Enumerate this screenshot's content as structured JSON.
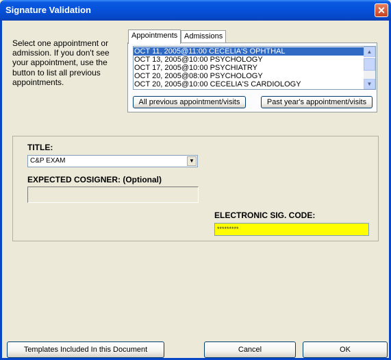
{
  "window": {
    "title": "Signature Validation",
    "close_glyph": "✕"
  },
  "instruction": "Select one appointment or admission.  If you don't see your appointment, use the button to list all previous appointments.",
  "tabs": [
    {
      "label": "Appointments",
      "active": true
    },
    {
      "label": "Admissions",
      "active": false
    }
  ],
  "appointments": [
    "OCT 11, 2005@11:00  CECELIA'S OPHTHAL",
    "OCT 13, 2005@10:00  PSYCHOLOGY",
    "OCT 17, 2005@10:00  PSYCHIATRY",
    "OCT 20, 2005@08:00  PSYCHOLOGY",
    "OCT 20, 2005@10:00  CECELIA'S CARDIOLOGY"
  ],
  "buttons": {
    "all_previous": "All previous appointment/visits",
    "past_year": "Past year's appointment/visits",
    "templates": "Templates Included In this Document",
    "cancel": "Cancel",
    "ok": "OK"
  },
  "title_field": {
    "label": "TITLE:",
    "value": "C&P EXAM"
  },
  "cosigner": {
    "label": "EXPECTED COSIGNER: (Optional)",
    "value": ""
  },
  "esig": {
    "label": "ELECTRONIC SIG. CODE:",
    "masked_value": "*********"
  },
  "colors": {
    "titlebar": "#0a59e0",
    "sig_field": "#ffff00",
    "selection": "#316ac5"
  }
}
